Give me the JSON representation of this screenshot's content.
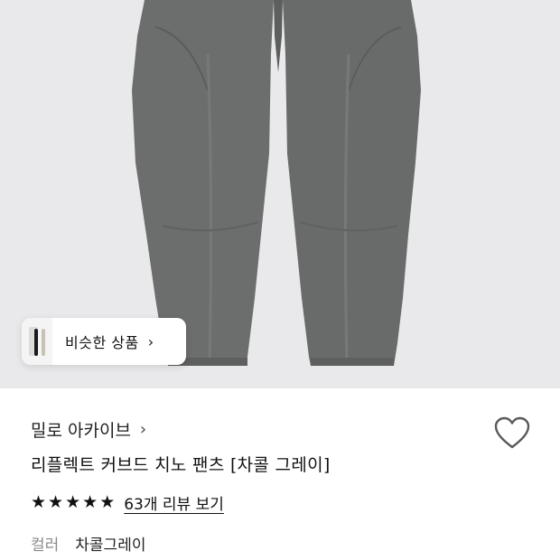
{
  "product": {
    "image_alt_color": "#6a6d6b",
    "background_color": "#e9e9eb",
    "similar_button_label": "비슷한 상품",
    "brand": "밀로 아카이브",
    "title": "리플렉트 커브드 치노 팬츠 [차콜 그레이]",
    "rating": {
      "stars": 5,
      "review_link": "63개 리뷰 보기"
    },
    "color_label": "컬러",
    "color_value": "차콜그레이"
  },
  "icons": {
    "chevron": "›",
    "star": "★",
    "wishlist": "heart-outline-icon"
  }
}
